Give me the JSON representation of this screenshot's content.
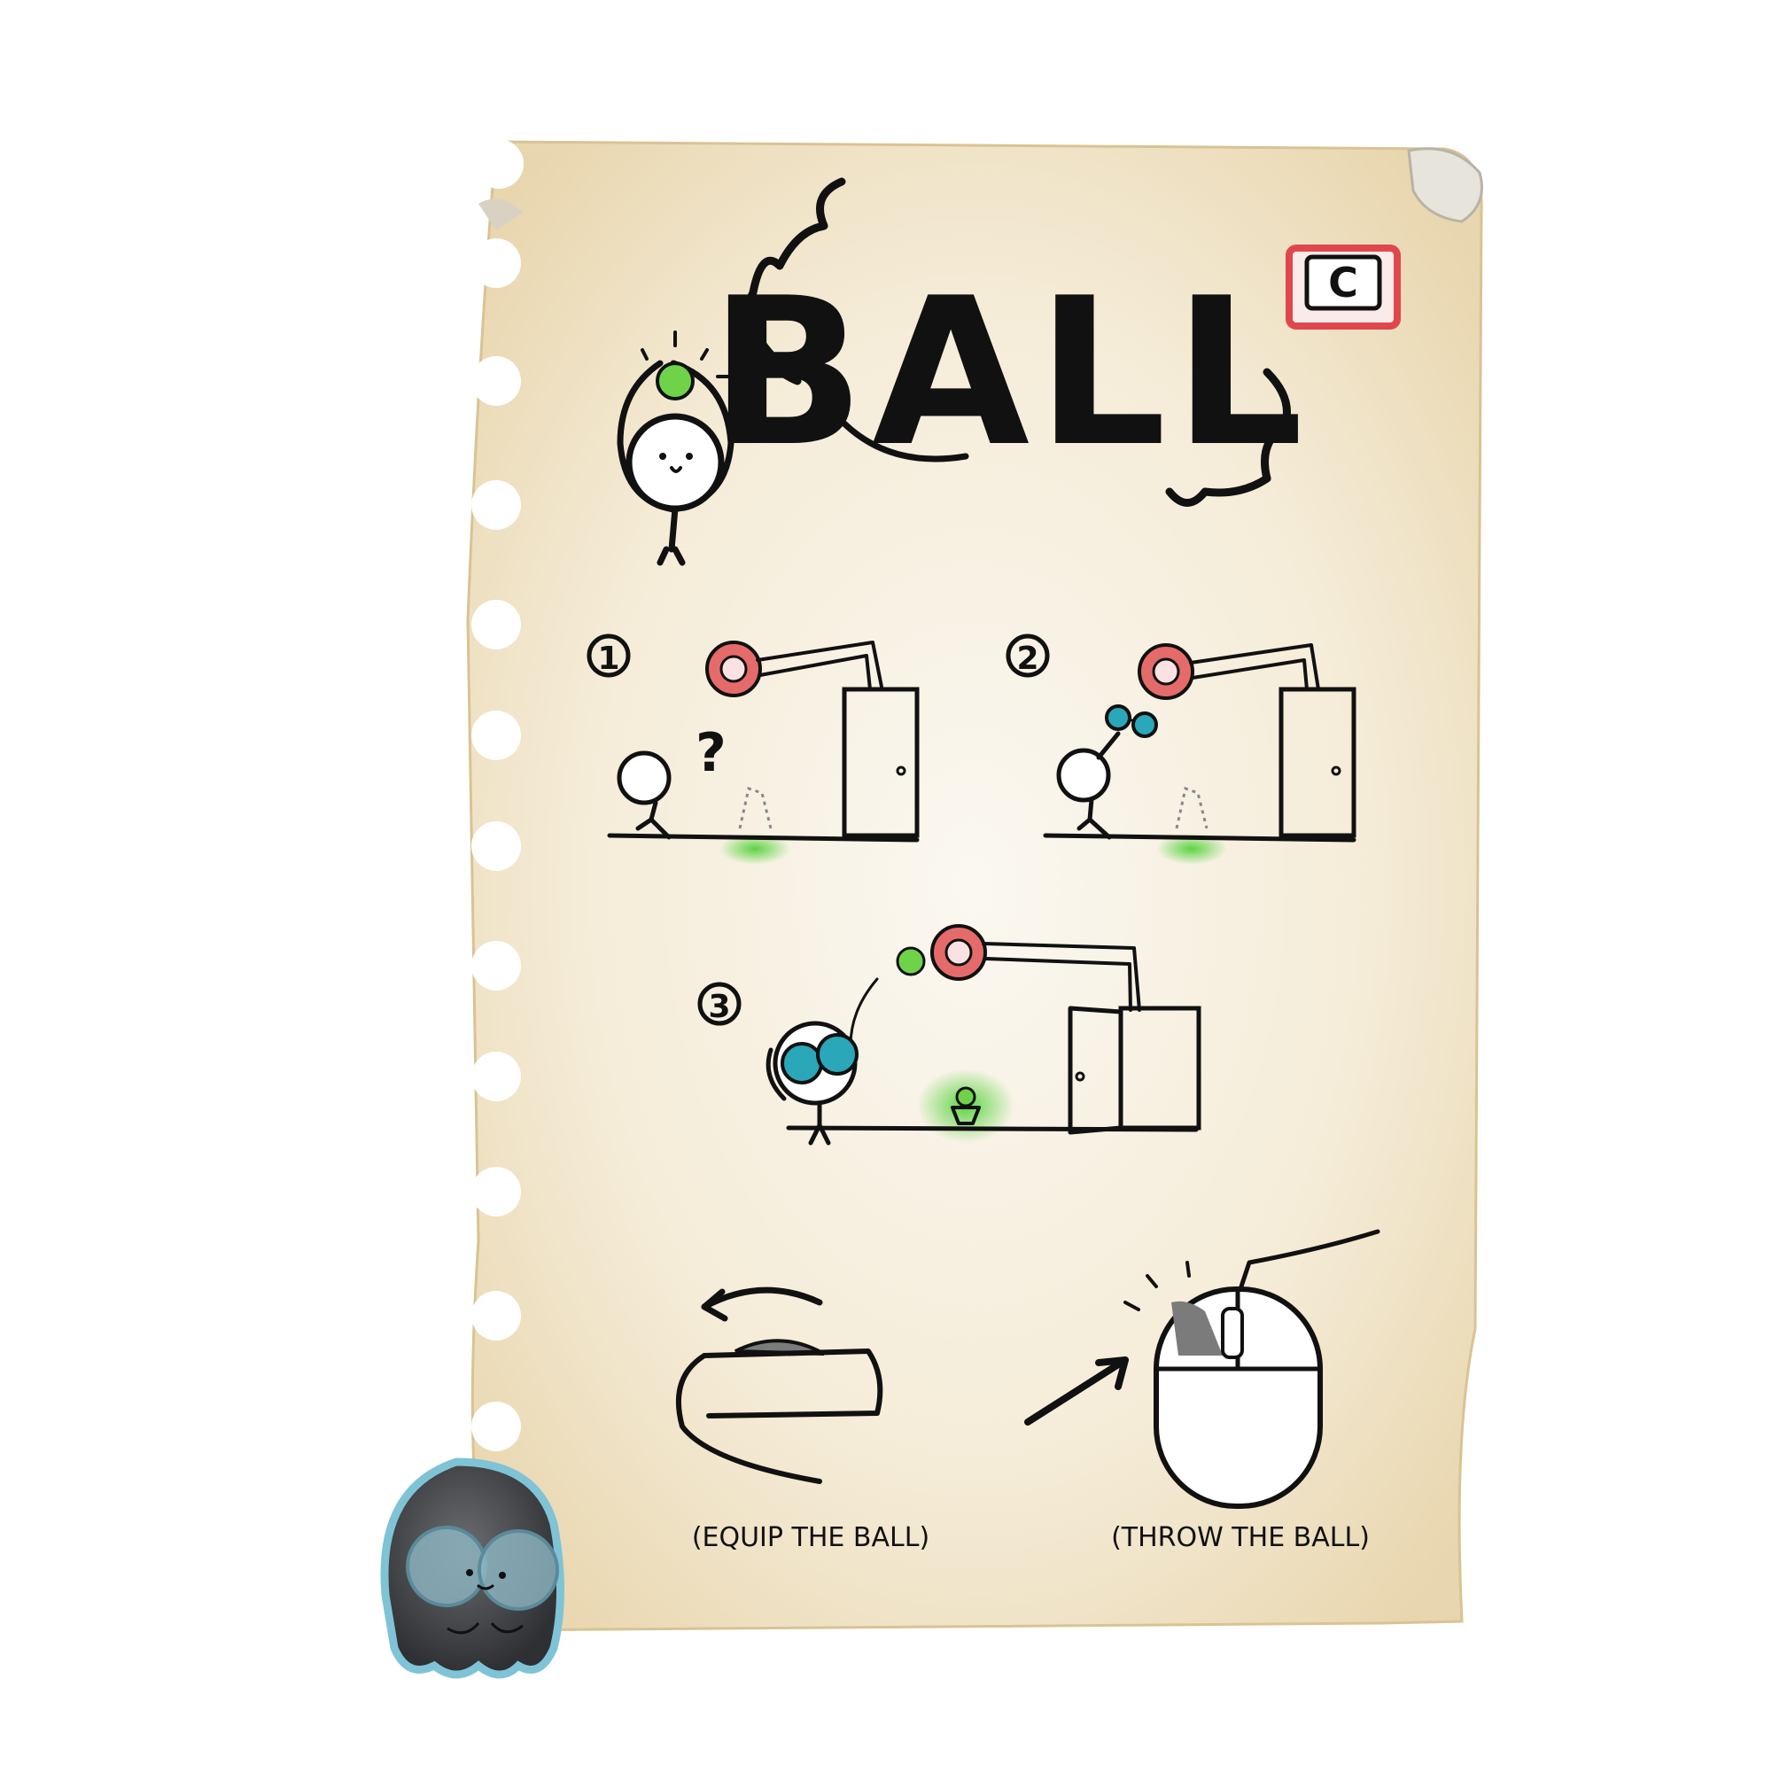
{
  "page": {
    "title": "BALL",
    "hotkey": {
      "key": "C",
      "accent_color": "#e0474c"
    },
    "panels": [
      {
        "step": "1"
      },
      {
        "step": "2"
      },
      {
        "step": "3"
      }
    ],
    "controls": {
      "equip_caption": "(EQUIP THE BALL)",
      "throw_caption": "(THROW THE BALL)",
      "equip_icon": "mouse-wheel-icon",
      "throw_icon": "mouse-left-click-icon"
    },
    "colors": {
      "paper": "#f3ead7",
      "ball_green": "#6fd34a",
      "target_red": "#e56b6b",
      "glasses_teal": "#2aa7b8",
      "ghost_gray": "#4d4f52"
    }
  }
}
